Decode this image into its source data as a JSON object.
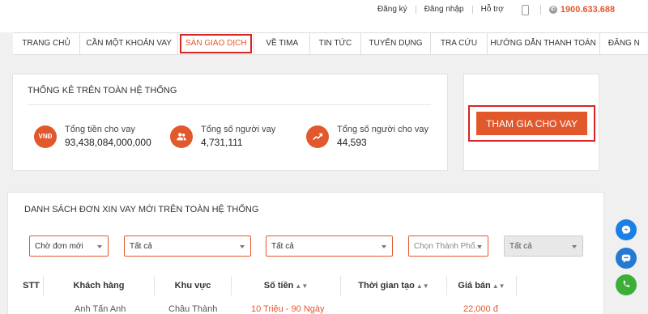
{
  "topbar": {
    "links": [
      "Đăng ký",
      "Đăng nhập",
      "Hỗ trợ"
    ],
    "hotline": "1900.633.688"
  },
  "nav": {
    "items": [
      "TRANG CHỦ",
      "CẦN MỘT KHOẢN VAY",
      "SÀN GIAO DỊCH",
      "VỀ TIMA",
      "TIN TỨC",
      "TUYỂN DỤNG",
      "TRA CỨU",
      "HƯỚNG DẪN THANH TOÁN",
      "ĐĂNG N"
    ],
    "active_index": 2
  },
  "stats": {
    "title": "THỐNG KÊ TRÊN TOÀN HỆ THỐNG",
    "items": [
      {
        "icon": "vnd-icon",
        "icon_text": "VNĐ",
        "label": "Tổng tiền cho vay",
        "value": "93,438,084,000,000"
      },
      {
        "icon": "users-icon",
        "icon_text": "",
        "label": "Tổng số người vay",
        "value": "4,731,111"
      },
      {
        "icon": "trend-up-icon",
        "icon_text": "",
        "label": "Tổng số người cho vay",
        "value": "44,593"
      }
    ]
  },
  "join": {
    "label": "THAM GIA CHO VAY"
  },
  "list": {
    "title": "DANH SÁCH ĐƠN XIN VAY MỚI TRÊN TOÀN HỆ THỐNG",
    "filters": [
      {
        "value": "Chờ đơn mới"
      },
      {
        "value": "Tất cả"
      },
      {
        "value": "Tất cả"
      },
      {
        "placeholder": "Chọn Thành Phố..."
      },
      {
        "value": "Tất cả",
        "disabled": true
      }
    ],
    "columns": [
      "STT",
      "Khách hàng",
      "Khu vực",
      "Số tiền",
      "Thời gian tạo",
      "Giá bán"
    ],
    "partial_row": {
      "customer": "Anh Tấn Anh",
      "area": "Châu Thành",
      "amount": "10 Triệu - 90 Ngày",
      "price": "22,000 đ"
    }
  },
  "colors": {
    "accent": "#e2582d",
    "highlight": "#d92424"
  },
  "side_buttons": [
    "messenger-icon",
    "zalo-icon",
    "phone-call-icon"
  ]
}
